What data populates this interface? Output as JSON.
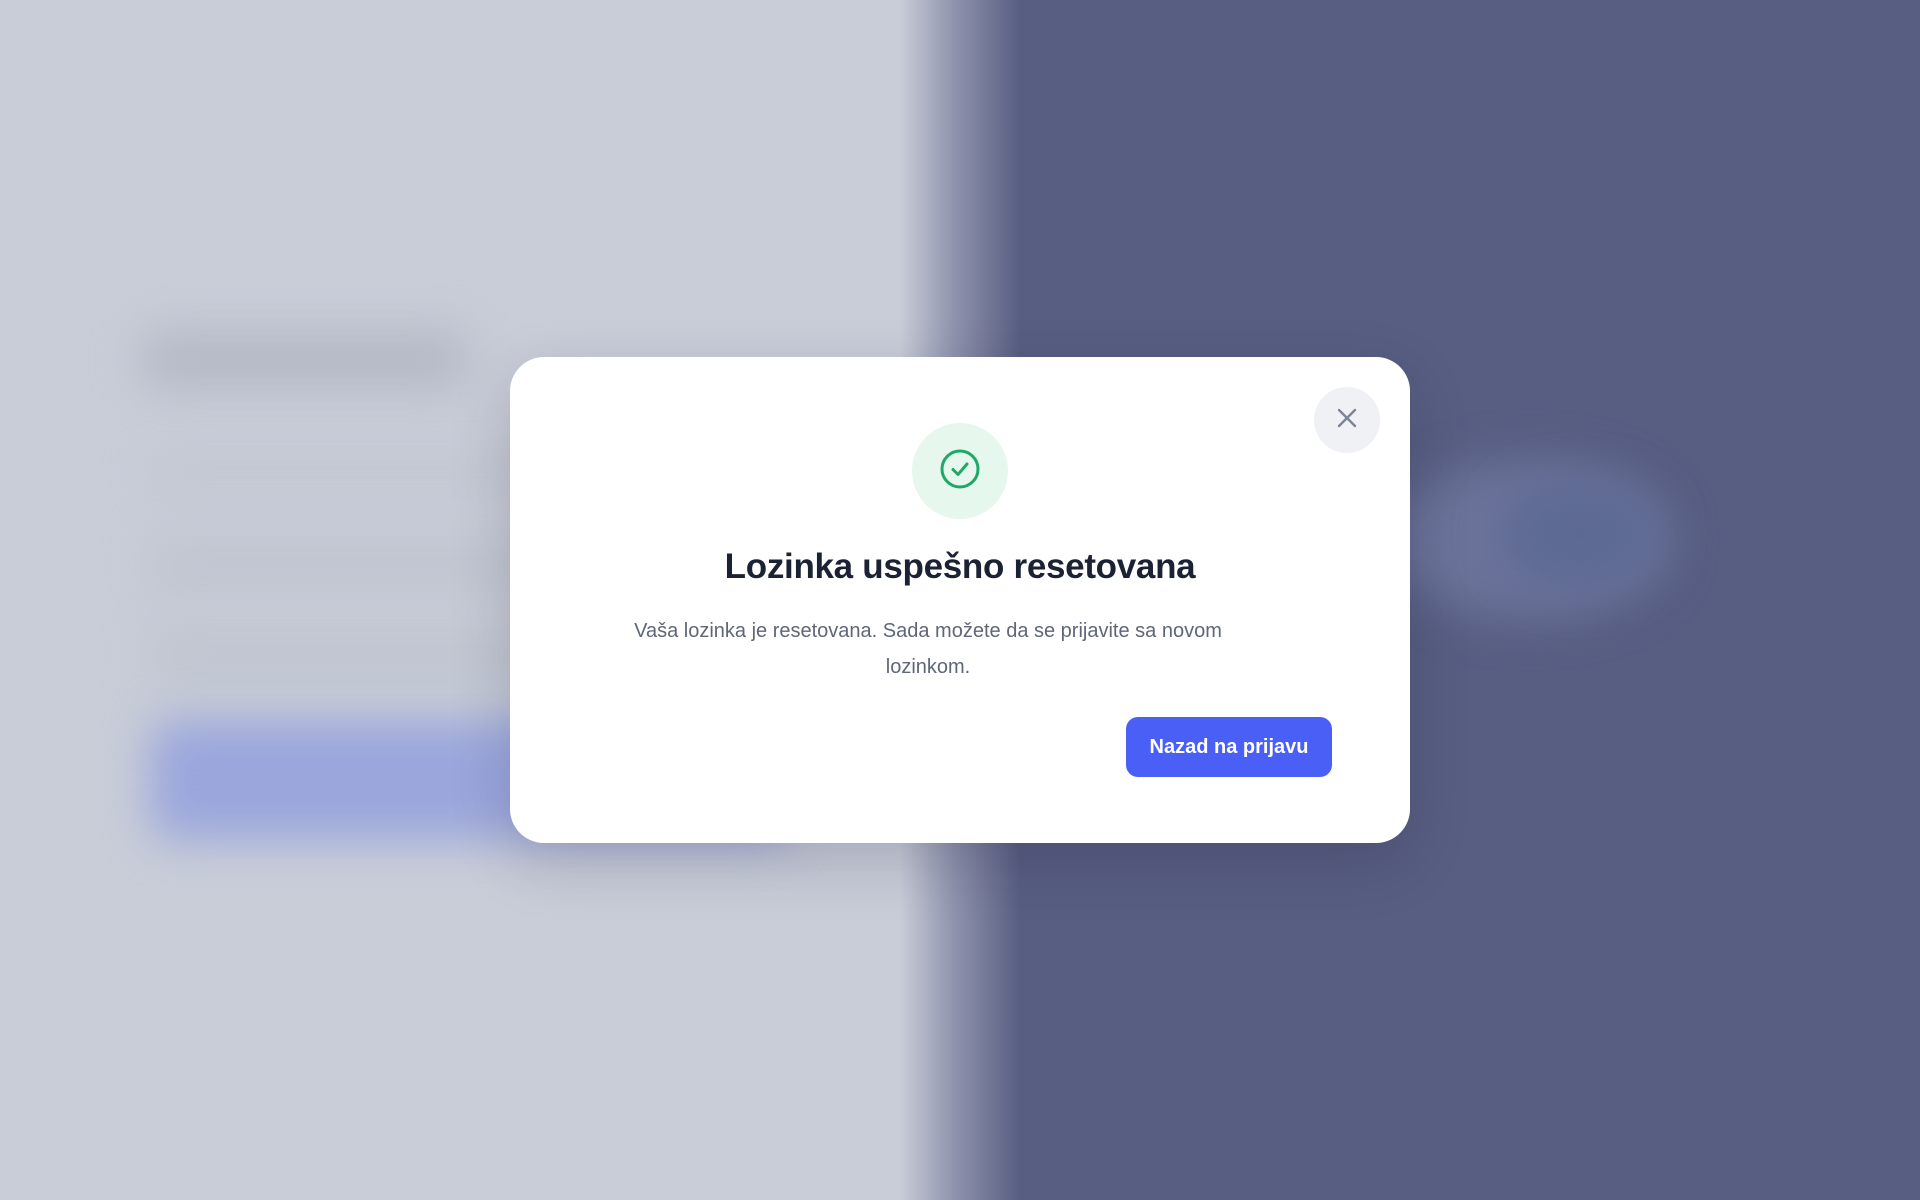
{
  "dialog": {
    "title": "Lozinka uspešno resetovana",
    "message": "Vaša lozinka je resetovana. Sada možete da se prijavite sa novom lozinkom.",
    "primary_button_label": "Nazad na prijavu",
    "close_icon": "close-icon",
    "status_icon": "check-circle-icon"
  },
  "colors": {
    "accent": "#4a5ff5",
    "success": "#1fa866",
    "success_bg": "#e6f8ee",
    "title": "#1b2233",
    "text": "#5f6679",
    "backdrop_left": "#c9cdd8",
    "backdrop_right": "#585e82"
  }
}
